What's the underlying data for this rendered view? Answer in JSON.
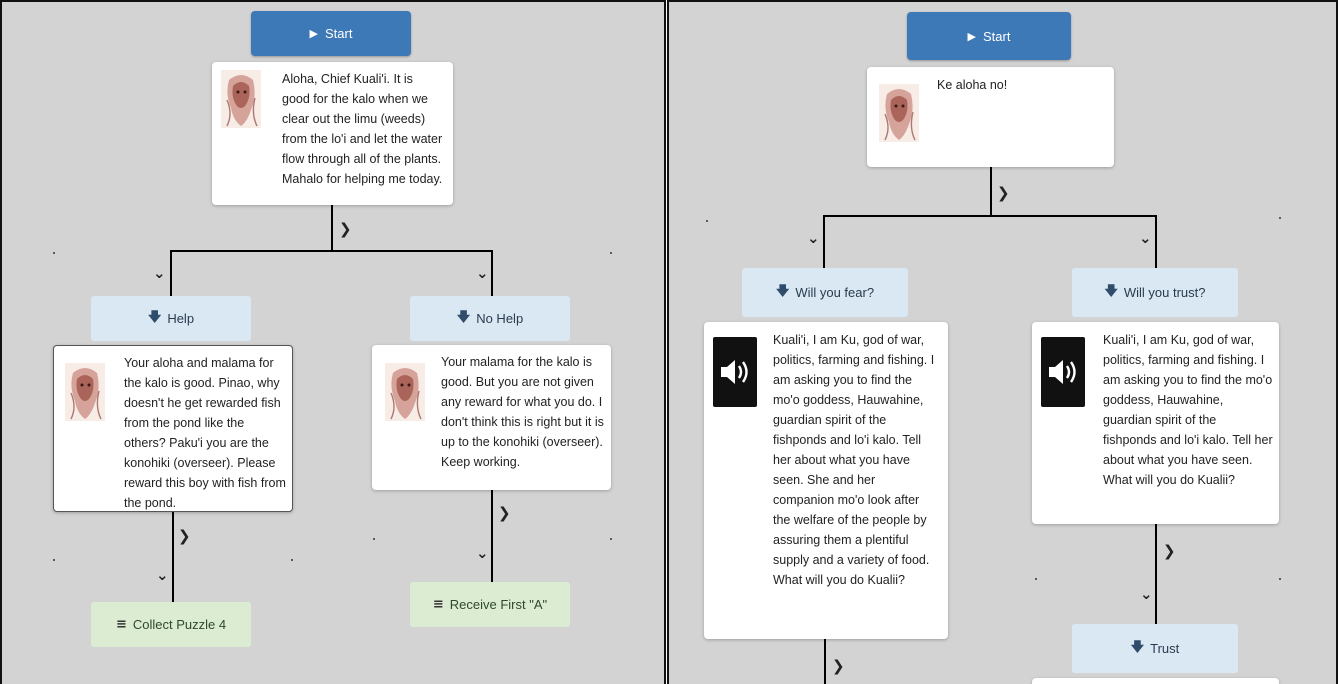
{
  "left": {
    "start_label": "Start",
    "intro_text": "Aloha, Chief Kuali'i. It is good for the kalo when we clear out the limu (weeds) from the lo'i and let the water flow through all of the plants. Mahalo for helping me today.",
    "branches": [
      {
        "choice_label": "Help",
        "response_text": "Your aloha and malama for the kalo is good. Pinao, why doesn't he get rewarded fish from the pond like the others? Paku'i you are the konohiki (overseer). Please reward this boy with fish from the pond.",
        "outcome_label": "Collect Puzzle 4"
      },
      {
        "choice_label": "No Help",
        "response_text": "Your malama for the kalo is good. But you are not given any reward for what you do. I don't think this is right but it is up to the konohiki (overseer). Keep working.",
        "outcome_label": "Receive First \"A\""
      }
    ]
  },
  "right": {
    "start_label": "Start",
    "intro_text": "Ke aloha no!",
    "branches": [
      {
        "choice_label": "Will you fear?",
        "response_text": "Kuali'i, I am Ku, god of war, politics, farming and fishing. I am asking you to find the mo'o goddess, Hauwahine, guardian spirit of the fishponds and lo'i kalo. Tell her about what you have seen. She and her companion mo'o look after the welfare of the people by assuring them a plentiful supply and a variety of food. What will you do Kualii?"
      },
      {
        "choice_label": "Will you trust?",
        "response_text": "Kuali'i, I am Ku, god of war, politics, farming and fishing. I am asking you to find the mo'o goddess, Hauwahine, guardian spirit of the fishponds and lo'i kalo. Tell her about what you have seen. What will you do Kualii?",
        "next_choice_label": "Trust"
      }
    ]
  },
  "icons": {
    "play": "play-icon",
    "down_arrow": "arrow-down-icon",
    "chevron_right": "chevron-right-icon",
    "chevron_down": "chevron-down-icon",
    "list": "list-icon",
    "speaker": "speaker-icon"
  },
  "colors": {
    "start_button": "#3d78b7",
    "choice_bg": "#d9e8f3",
    "outcome_bg": "#dbecd3",
    "canvas_bg": "#d3d3d3"
  }
}
